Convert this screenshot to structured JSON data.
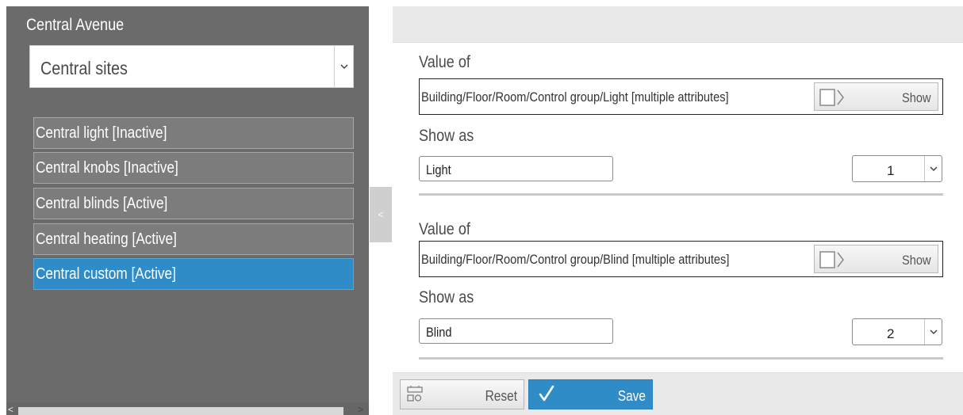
{
  "sidebar": {
    "location_title": "Central Avenue",
    "site_select": {
      "value": "Central sites"
    },
    "items": [
      {
        "label": "Central light [Inactive]"
      },
      {
        "label": "Central knobs [Inactive]"
      },
      {
        "label": "Central blinds [Active]"
      },
      {
        "label": "Central heating [Active]"
      },
      {
        "label": "Central custom [Active]",
        "selected": true
      }
    ],
    "collapse_glyph": "<",
    "scroll_left_glyph": "<",
    "scroll_right_glyph": ">"
  },
  "entries": [
    {
      "value_of_label": "Value of",
      "path": "Building/Floor/Room/Control group/Light [multiple attributes]",
      "show_button": "Show",
      "show_as_label": "Show as",
      "show_as_value": "Light",
      "number": "1"
    },
    {
      "value_of_label": "Value of",
      "path": "Building/Floor/Room/Control group/Blind [multiple attributes]",
      "show_button": "Show",
      "show_as_label": "Show as",
      "show_as_value": "Blind",
      "number": "2"
    }
  ],
  "toolbar": {
    "reset_label": "Reset",
    "save_label": "Save",
    "reset_icon": "reset-icon",
    "save_icon": "checkmark-icon"
  },
  "colors": {
    "accent": "#2f8cc6",
    "sidebar_bg": "#6b6b6b",
    "item_bg": "#7c7c7c"
  }
}
